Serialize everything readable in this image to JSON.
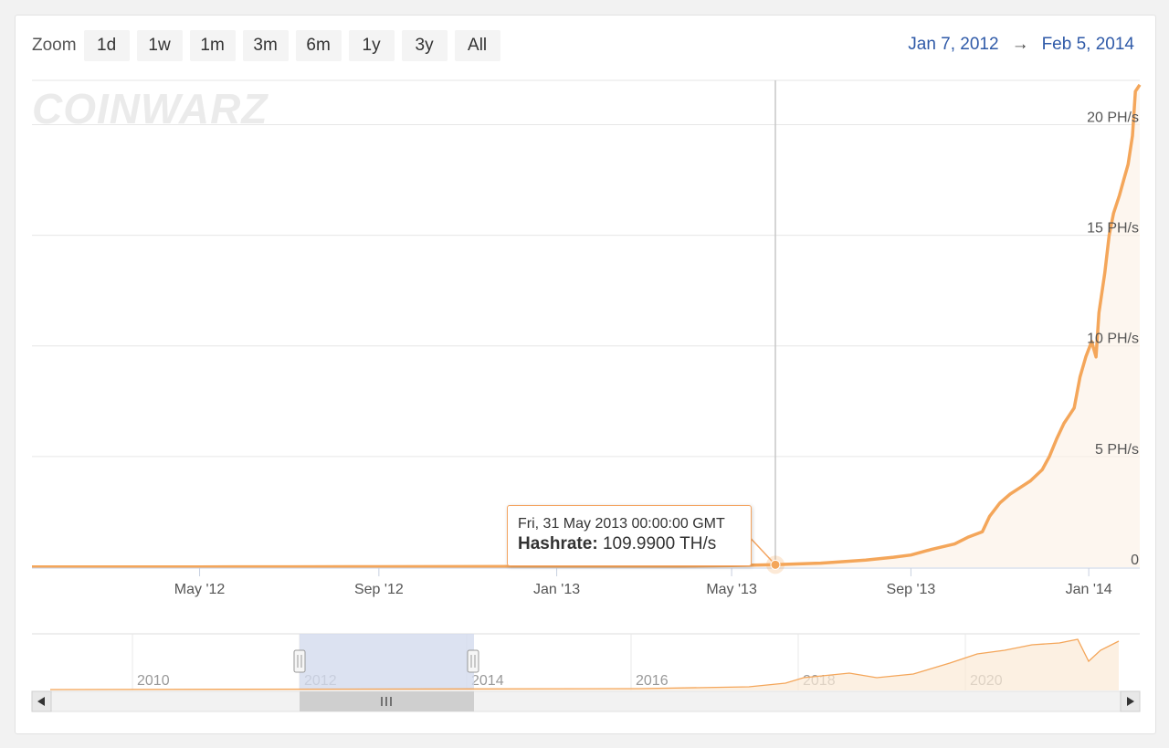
{
  "zoom": {
    "label": "Zoom",
    "buttons": [
      "1d",
      "1w",
      "1m",
      "3m",
      "6m",
      "1y",
      "3y",
      "All"
    ]
  },
  "range": {
    "from": "Jan 7, 2012",
    "arrow": "→",
    "to": "Feb 5, 2014"
  },
  "watermark": "COINWARZ",
  "tooltip": {
    "date": "Fri, 31 May 2013 00:00:00 GMT",
    "series": "Hashrate:",
    "value": "109.9900 TH/s"
  },
  "colors": {
    "series": "#f4a65a",
    "accent": "#2f5aa8",
    "navigator_selection": "#d3dbee"
  },
  "chart_data": {
    "type": "area",
    "title": "",
    "xlabel": "",
    "ylabel": "",
    "y_unit": "PH/s",
    "xlim": [
      "2012-01-07",
      "2014-02-05"
    ],
    "ylim": [
      0,
      22
    ],
    "yticks": [
      0,
      5,
      10,
      15,
      20
    ],
    "ytick_labels": [
      "0",
      "5 PH/s",
      "10 PH/s",
      "15 PH/s",
      "20 PH/s"
    ],
    "xticks": [
      "2012-05-01",
      "2012-09-01",
      "2013-01-01",
      "2013-05-01",
      "2013-09-01",
      "2014-01-01"
    ],
    "xtick_labels": [
      "May '12",
      "Sep '12",
      "Jan '13",
      "May '13",
      "Sep '13",
      "Jan '14"
    ],
    "grid": true,
    "legend": "none",
    "series": [
      {
        "name": "Hashrate",
        "x": [
          "2012-01-07",
          "2012-03-01",
          "2012-05-01",
          "2012-07-01",
          "2012-09-01",
          "2012-11-01",
          "2013-01-01",
          "2013-03-01",
          "2013-05-01",
          "2013-05-31",
          "2013-07-01",
          "2013-08-01",
          "2013-08-20",
          "2013-09-01",
          "2013-09-15",
          "2013-10-01",
          "2013-10-10",
          "2013-10-20",
          "2013-10-25",
          "2013-11-01",
          "2013-11-08",
          "2013-11-15",
          "2013-11-22",
          "2013-11-30",
          "2013-12-05",
          "2013-12-10",
          "2013-12-15",
          "2013-12-18",
          "2013-12-22",
          "2013-12-26",
          "2013-12-30",
          "2014-01-03",
          "2014-01-06",
          "2014-01-08",
          "2014-01-12",
          "2014-01-15",
          "2014-01-18",
          "2014-01-22",
          "2014-01-25",
          "2014-01-28",
          "2014-01-31",
          "2014-02-02",
          "2014-02-05"
        ],
        "y": [
          0.01,
          0.012,
          0.013,
          0.016,
          0.02,
          0.026,
          0.03,
          0.04,
          0.07,
          0.11,
          0.18,
          0.32,
          0.45,
          0.55,
          0.8,
          1.05,
          1.35,
          1.6,
          2.3,
          2.9,
          3.3,
          3.6,
          3.9,
          4.4,
          5.0,
          5.8,
          6.5,
          6.8,
          7.2,
          8.6,
          9.5,
          10.2,
          9.5,
          11.5,
          13.3,
          15.0,
          16.0,
          16.8,
          17.5,
          18.2,
          19.5,
          21.5,
          21.8
        ]
      }
    ],
    "crosshair": {
      "x": "2013-05-31",
      "y": 0.11
    },
    "navigator": {
      "xtick_labels": [
        "2010",
        "2012",
        "2014",
        "2016",
        "2018",
        "2020"
      ],
      "selection": [
        "2012-01-07",
        "2014-02-05"
      ]
    }
  }
}
